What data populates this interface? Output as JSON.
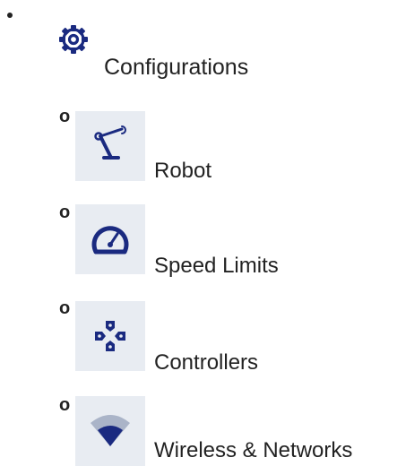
{
  "menu": {
    "configurations": {
      "label": "Configurations",
      "icon": "gear-icon"
    },
    "items": [
      {
        "label": "Robot",
        "icon": "robot-arm-icon",
        "marker": "o"
      },
      {
        "label": "Speed Limits",
        "icon": "speedometer-icon",
        "marker": "o"
      },
      {
        "label": "Controllers",
        "icon": "dpad-icon",
        "marker": "o"
      },
      {
        "label": "Wireless & Networks",
        "icon": "wifi-icon",
        "marker": "o"
      }
    ]
  },
  "colors": {
    "icon": "#1a2a80",
    "tile": "#e8ecf2"
  }
}
